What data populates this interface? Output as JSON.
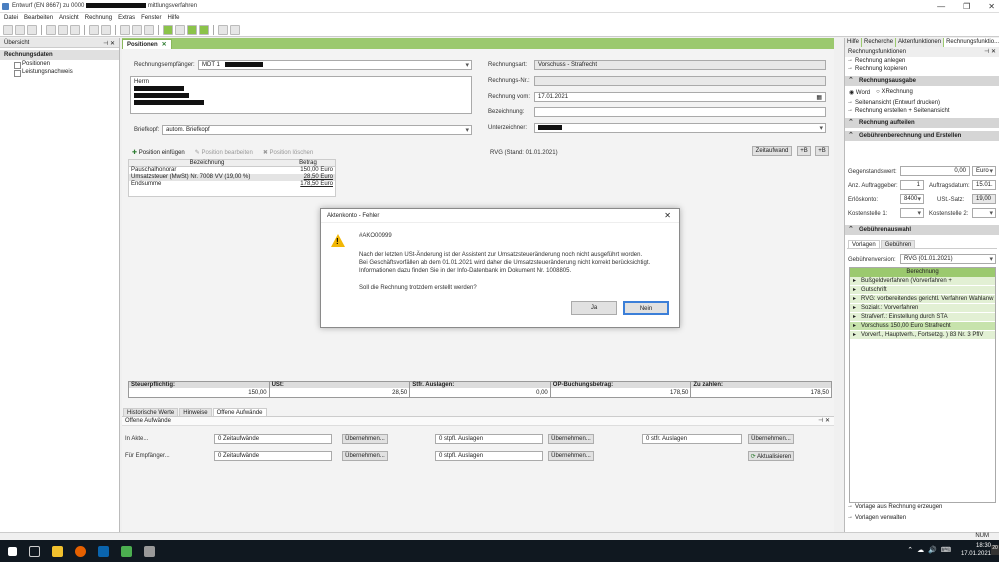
{
  "window": {
    "title_prefix": "Entwurf (EN 8667) zu 0000",
    "title_suffix": "mittlungsverfahren",
    "controls": [
      "—",
      "❐",
      "✕"
    ]
  },
  "menu": [
    "Datei",
    "Bearbeiten",
    "Ansicht",
    "Rechnung",
    "Extras",
    "Fenster",
    "Hilfe"
  ],
  "left_panel": {
    "header": "Übersicht",
    "pin": "⊣ ✕",
    "section": "Rechnungsdaten",
    "items": [
      "Positionen",
      "Leistungsnachweis"
    ]
  },
  "center": {
    "tab_label": "Positionen",
    "tab_close": "✕",
    "recipient_label": "Rechnungsempfänger:",
    "recipient_value": "MDT 1",
    "address_lines": [
      "Herrn"
    ],
    "letterhead_label": "Briefkopf:",
    "letterhead_value": "autom. Briefkopf",
    "invoice_type_label": "Rechnungsart:",
    "invoice_type_value": "Vorschuss - Strafrecht",
    "invoice_no_label": "Rechnungs-Nr.:",
    "invoice_date_label": "Rechnung vom:",
    "invoice_date_value": "17.01.2021",
    "description_label": "Bezeichnung:",
    "signer_label": "Unterzeichner:",
    "actions": {
      "insert": "Position einfügen",
      "edit": "Position bearbeiten",
      "delete": "Position löschen"
    },
    "rvg_label": "RVG (Stand: 01.01.2021)",
    "time_value_button": "Zeitaufwand",
    "plus_buttons": [
      "+B",
      "+B"
    ],
    "table": {
      "headers": [
        "Bezeichnung",
        "Betrag"
      ],
      "rows": [
        {
          "label": "Pauschalhonorar",
          "amount": "150,00 Euro"
        },
        {
          "label": "Umsatzsteuer (MwSt) Nr. 7008 VV (19,00 %)",
          "amount": "28,50 Euro"
        },
        {
          "label": "Endsumme",
          "amount": "178,50 Euro"
        }
      ]
    },
    "summary": [
      {
        "label": "Steuerpflichtig:",
        "value": "150,00"
      },
      {
        "label": "USt:",
        "value": "28,50"
      },
      {
        "label": "Stfr. Auslagen:",
        "value": "0,00"
      },
      {
        "label": "OP-Buchungsbetrag:",
        "value": "178,50"
      },
      {
        "label": "Zu zahlen:",
        "value": "178,50"
      }
    ]
  },
  "bottom": {
    "tabs": [
      "Historische Werte",
      "Hinweise",
      "Offene Aufwände"
    ],
    "panel_title": "Offene Aufwände",
    "rows": [
      {
        "label": "In Akte...",
        "c1": "0 Zeitaufwände",
        "c2": "0 stpfl. Auslagen",
        "c3": "0 stfr. Auslagen"
      },
      {
        "label": "Für Empfänger...",
        "c1": "0 Zeitaufwände",
        "c2": "0 stpfl. Auslagen",
        "c3": "0 stfr. Auslagen"
      }
    ],
    "accept_label": "Übernehmen...",
    "refresh_label": "Aktualisieren"
  },
  "right_panel": {
    "tabs": [
      "Hilfe",
      "Recherche",
      "Aktenfunktionen",
      "Rechnungsfunktio..."
    ],
    "panel_title": "Rechnungsfunktionen",
    "links_top": [
      "Rechnung anlegen",
      "Rechnung kopieren"
    ],
    "sec_output": "Rechnungsausgabe",
    "radio_word": "Word",
    "radio_x": "XRechnung",
    "links_output": [
      "Seitenansicht (Entwurf drucken)",
      "Rechnung erstellen + Seitenansicht"
    ],
    "sec_split": "Rechnung aufteilen",
    "sec_fees": "Gebührenberechnung und Erstellen",
    "object_value_label": "Gegenstandswert:",
    "object_value": "0,00",
    "currency": "Euro",
    "clients_label": "Anz. Auftraggeber:",
    "clients_value": "1",
    "order_date_label": "Auftragsdatum:",
    "order_date_value": "15.01.",
    "revenue_label": "Erlöskonto:",
    "revenue_value": "8400",
    "vat_label": "USt.-Satz:",
    "vat_value": "19,00",
    "cost1_label": "Kostenstelle 1:",
    "cost2_label": "Kostenstelle 2:",
    "sec_selection": "Gebührenauswahl",
    "sel_tabs": [
      "Vorlagen",
      "Gebühren"
    ],
    "version_label": "Gebührenversion:",
    "version_value": "RVG (01.01.2021)",
    "list_header": "Berechnung",
    "list": [
      "Bußgeldverfahren (Vorverfahren + Gerichtsverfah...",
      "Gutschrift",
      "RVG: vorbereitendes gerichtl. Verfahren Wahlanw",
      "Sozialr.: Vorverfahren",
      "Strafverf.: Einstellung durch STA",
      "Vorschuss 150,00 Euro Strafrecht",
      "Vorverf., Hauptverh., Fortsetzg. ) 83 Nr. 3 PflV"
    ],
    "links_bottom": [
      "Vorlage aus Rechnung erzeugen",
      "Vorlagen verwalten"
    ]
  },
  "dialog": {
    "title": "Aktenkonto - Fehler",
    "close": "✕",
    "code": "#AKO00999",
    "lines": [
      "Nach der letzten USt-Änderung ist der Assistent zur Umsatzsteueränderung noch nicht ausgeführt worden.",
      "Bei Geschäftsvorfällen ab dem 01.01.2021 wird daher die Umsatzsteueränderung nicht korrekt berücksichtigt.",
      "Informationen dazu finden Sie in der Info-Datenbank im Dokument Nr. 1008805."
    ],
    "question": "Soll die Rechnung trotzdem erstellt werden?",
    "yes": "Ja",
    "no": "Nein"
  },
  "status": {
    "num": "NUM"
  },
  "taskbar": {
    "time": "18:30",
    "date": "17.01.2021",
    "badge": "20"
  }
}
